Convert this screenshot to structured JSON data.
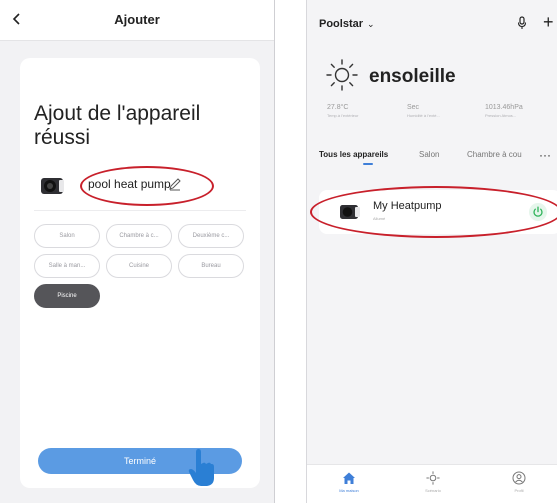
{
  "left": {
    "header_title": "Ajouter",
    "success_title": "Ajout de l'appareil réussi",
    "device_name": "pool heat pump",
    "rooms": [
      {
        "label": "Salon",
        "selected": false
      },
      {
        "label": "Chambre à c...",
        "selected": false
      },
      {
        "label": "Deuxième c...",
        "selected": false
      },
      {
        "label": "Salle à man...",
        "selected": false
      },
      {
        "label": "Cuisine",
        "selected": false
      },
      {
        "label": "Bureau",
        "selected": false
      },
      {
        "label": "Piscine",
        "selected": true
      }
    ],
    "done_label": "Terminé"
  },
  "right": {
    "home_name": "Poolstar",
    "weather_title": "ensoleille",
    "stats": [
      {
        "value": "27.8°C",
        "label": "Temp.à l'extérieur"
      },
      {
        "value": "Sec",
        "label": "Humidité à l'exté..."
      },
      {
        "value": "1013.46hPa",
        "label": "Pression Atmos..."
      }
    ],
    "tabs": [
      {
        "label": "Tous les appareils",
        "active": true
      },
      {
        "label": "Salon",
        "active": false
      },
      {
        "label": "Chambre à cou",
        "active": false
      }
    ],
    "device": {
      "name": "My Heatpump",
      "status": "Allumé"
    },
    "nav": [
      {
        "label": "Ma maison",
        "icon": "home-icon",
        "active": true
      },
      {
        "label": "Scénario",
        "icon": "sun-icon",
        "active": false
      },
      {
        "label": "Profil",
        "icon": "profile-icon",
        "active": false
      }
    ]
  },
  "colors": {
    "accent": "#5b9be3",
    "highlight": "#c8202b",
    "power": "#2fb45a"
  }
}
